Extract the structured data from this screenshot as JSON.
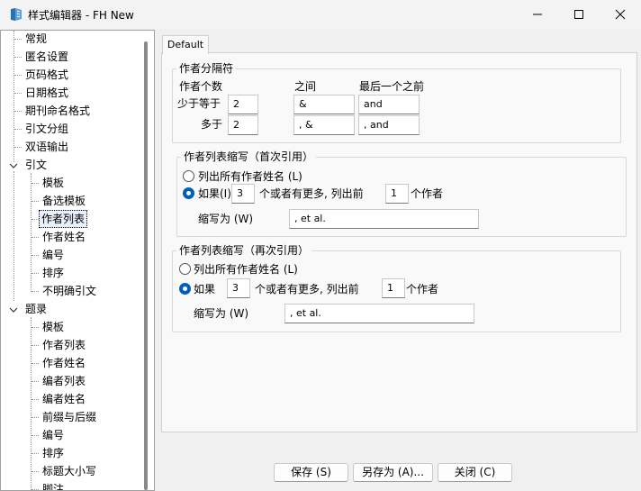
{
  "window": {
    "title": "样式编辑器 - FH New"
  },
  "tree": {
    "items": [
      {
        "label": "常规"
      },
      {
        "label": "匿名设置"
      },
      {
        "label": "页码格式"
      },
      {
        "label": "日期格式"
      },
      {
        "label": "期刊命名格式"
      },
      {
        "label": "引文分组"
      },
      {
        "label": "双语输出"
      },
      {
        "label": "引文"
      },
      {
        "label": "模板"
      },
      {
        "label": "备选模板"
      },
      {
        "label": "作者列表"
      },
      {
        "label": "作者姓名"
      },
      {
        "label": "编号"
      },
      {
        "label": "排序"
      },
      {
        "label": "不明确引文"
      },
      {
        "label": "题录"
      },
      {
        "label": "模板"
      },
      {
        "label": "作者列表"
      },
      {
        "label": "作者姓名"
      },
      {
        "label": "编者列表"
      },
      {
        "label": "编者姓名"
      },
      {
        "label": "前缀与后缀"
      },
      {
        "label": "编号"
      },
      {
        "label": "排序"
      },
      {
        "label": "标题大小写"
      },
      {
        "label": "脚注"
      }
    ]
  },
  "tab": {
    "label": "Default"
  },
  "separators": {
    "title": "作者分隔符",
    "col_count": "作者个数",
    "col_between": "之间",
    "col_last": "最后一个之前",
    "row1_label": "少于等于",
    "row1_count": "2",
    "row1_between": " &",
    "row1_last": "and",
    "row2_label": "多于",
    "row2_count": "2",
    "row2_between": ", &",
    "row2_last": ", and"
  },
  "first_cite": {
    "title": "作者列表缩写（首次引用）",
    "list_all": "列出所有作者姓名 (L)",
    "if_label": "如果(I)",
    "if_count": "3",
    "more_text": "个或者有更多, 列出前",
    "list_count": "1",
    "authors_text": "个作者",
    "abbr_label": "缩写为 (W)",
    "abbr_value": ", et al."
  },
  "subsequent_cite": {
    "title": "作者列表缩写（再次引用）",
    "list_all": "列出所有作者姓名 (L)",
    "if_label": "如果",
    "if_count": "3",
    "more_text": "个或者有更多, 列出前",
    "list_count": "1",
    "authors_text": "个作者",
    "abbr_label": "缩写为 (W)",
    "abbr_value": ", et al."
  },
  "buttons": {
    "save": "保存 (S)",
    "save_as": "另存为 (A)...",
    "close": "关闭 (C)"
  }
}
